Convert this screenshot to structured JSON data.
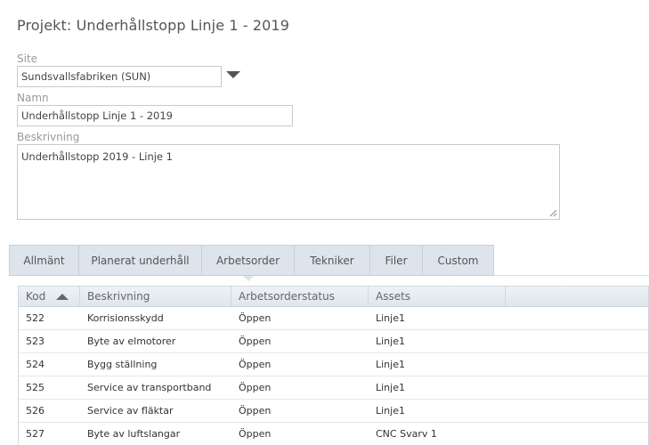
{
  "title": "Projekt: Underhållstopp Linje 1 - 2019",
  "form": {
    "site_label": "Site",
    "site_value": "Sundsvallsfabriken (SUN)",
    "name_label": "Namn",
    "name_value": "Underhållstopp Linje 1 - 2019",
    "desc_label": "Beskrivning",
    "desc_value": "Underhållstopp 2019 - Linje 1"
  },
  "tabs": [
    {
      "label": "Allmänt",
      "active": false
    },
    {
      "label": "Planerat underhåll",
      "active": false
    },
    {
      "label": "Arbetsorder",
      "active": true
    },
    {
      "label": "Tekniker",
      "active": false
    },
    {
      "label": "Filer",
      "active": false
    },
    {
      "label": "Custom",
      "active": false
    }
  ],
  "table": {
    "columns": [
      "Kod",
      "Beskrivning",
      "Arbetsorderstatus",
      "Assets"
    ],
    "rows": [
      {
        "kod": "522",
        "beskrivning": "Korrisionsskydd",
        "status": "Öppen",
        "assets": "Linje1"
      },
      {
        "kod": "523",
        "beskrivning": "Byte av elmotorer",
        "status": "Öppen",
        "assets": "Linje1"
      },
      {
        "kod": "524",
        "beskrivning": "Bygg ställning",
        "status": "Öppen",
        "assets": "Linje1"
      },
      {
        "kod": "525",
        "beskrivning": "Service av transportband",
        "status": "Öppen",
        "assets": "Linje1"
      },
      {
        "kod": "526",
        "beskrivning": "Service av fläktar",
        "status": "Öppen",
        "assets": "Linje1"
      },
      {
        "kod": "527",
        "beskrivning": "Byte av luftslangar",
        "status": "Öppen",
        "assets": "CNC Svarv 1"
      }
    ]
  },
  "colors": {
    "tab_bg": "#dde4ec",
    "header_bg": "#e6ecf1"
  }
}
